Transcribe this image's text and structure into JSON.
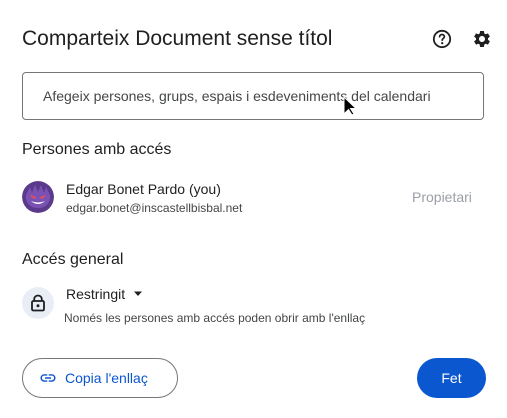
{
  "dialog": {
    "title": "Comparteix Document sense títol",
    "help_icon": "help-circle-icon",
    "settings_icon": "gear-icon"
  },
  "add_people": {
    "placeholder": "Afegeix persones, grups, espais i esdeveniments del calendari"
  },
  "people_section": {
    "heading": "Persones amb accés",
    "people": [
      {
        "name": "Edgar Bonet Pardo (you)",
        "email": "edgar.bonet@inscastellbisbal.net",
        "role": "Propietari",
        "avatar_icon": "gengar-avatar-icon"
      }
    ]
  },
  "general_access": {
    "heading": "Accés general",
    "value": "Restringit",
    "description": "Només les persones amb accés poden obrir amb l'enllaç",
    "icon": "lock-icon"
  },
  "footer": {
    "copy_link_label": "Copia l'enllaç",
    "done_label": "Fet"
  },
  "colors": {
    "accent": "#0b57d0",
    "text": "#1f1f1f",
    "secondary_text": "#444746",
    "disabled_text": "#9aa0a6",
    "lock_bg": "#e9eef6"
  }
}
